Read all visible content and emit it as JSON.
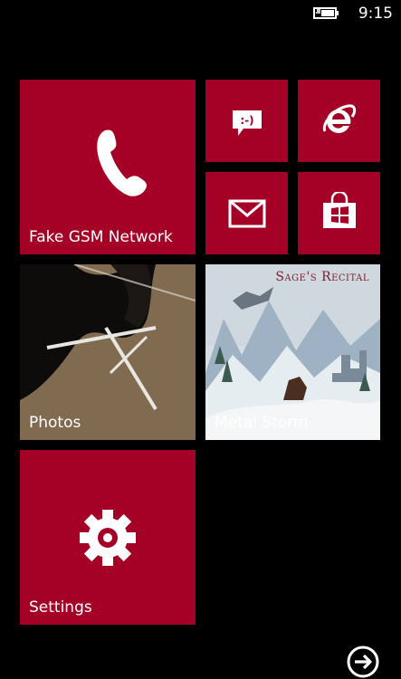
{
  "status_bar": {
    "time": "9:15",
    "battery_icon": "battery-charging-icon"
  },
  "accent_color": "#a50025",
  "tiles": {
    "phone": {
      "label": "Fake GSM Network",
      "icon": "phone-handset-icon"
    },
    "messaging": {
      "label": "",
      "icon": "messaging-smiley-icon"
    },
    "browser": {
      "label": "",
      "icon": "internet-explorer-icon"
    },
    "mail": {
      "label": "",
      "icon": "mail-envelope-icon"
    },
    "store": {
      "label": "",
      "icon": "store-bag-icon"
    },
    "photos": {
      "label": "Photos"
    },
    "music": {
      "label": "Metal Storm",
      "album_art_title": "Sage's Recital"
    },
    "settings": {
      "label": "Settings",
      "icon": "gear-icon"
    }
  },
  "app_list_button": {
    "icon": "arrow-right-circle-icon"
  }
}
